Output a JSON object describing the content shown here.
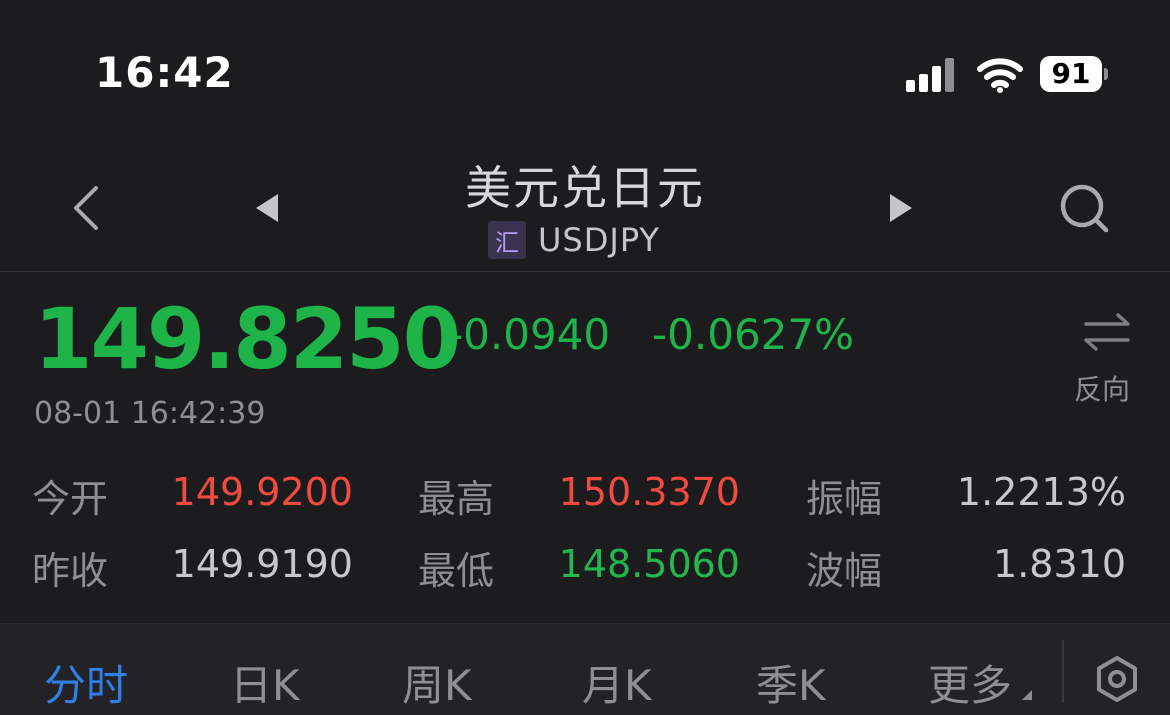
{
  "status_bar": {
    "time": "16:42",
    "battery": "91"
  },
  "header": {
    "title": "美元兑日元",
    "badge": "汇",
    "code": "USDJPY"
  },
  "quote": {
    "price": "149.8250",
    "change": "-0.0940",
    "change_pct": "-0.0627%",
    "timestamp": "08-01 16:42:39",
    "reverse_label": "反向"
  },
  "stats": [
    {
      "label": "今开",
      "value": "149.9200"
    },
    {
      "label": "最高",
      "value": "150.3370"
    },
    {
      "label": "振幅",
      "value": "1.2213%"
    },
    {
      "label": "昨收",
      "value": "149.9190"
    },
    {
      "label": "最低",
      "value": "148.5060"
    },
    {
      "label": "波幅",
      "value": "1.8310"
    }
  ],
  "tabs": [
    "分时",
    "日K",
    "周K",
    "月K",
    "季K",
    "更多"
  ],
  "colors": {
    "up": "#f24a3f",
    "down": "#1fb449",
    "accent": "#2f7fe6",
    "background": "#1c1c1e"
  },
  "icons": [
    "back-icon",
    "prev-icon",
    "next-icon",
    "search-icon",
    "reverse-icon",
    "settings-icon",
    "signal-icon",
    "wifi-icon",
    "battery-icon"
  ]
}
